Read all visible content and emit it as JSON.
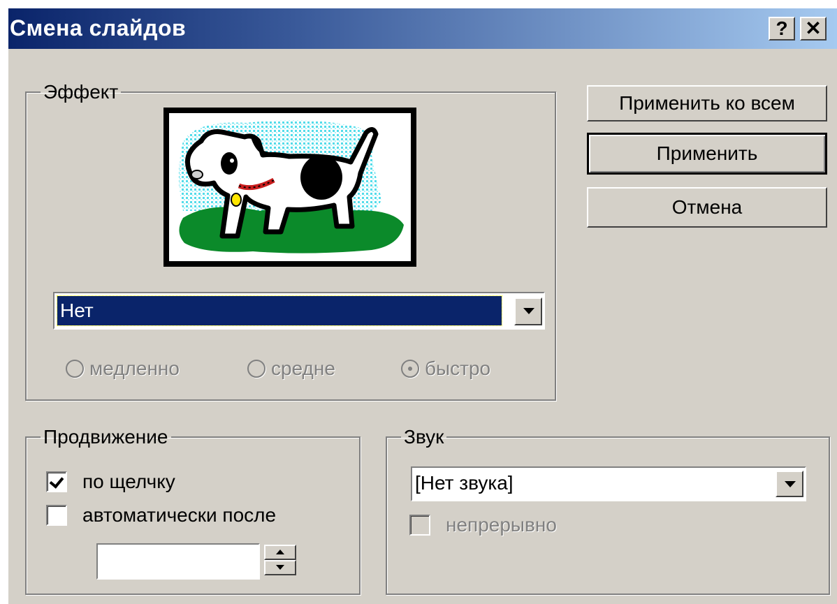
{
  "window": {
    "title": "Смена слайдов",
    "help_label": "?",
    "close_label": "✕"
  },
  "buttons": {
    "apply_all": "Применить ко всем",
    "apply": "Применить",
    "cancel": "Отмена"
  },
  "effect": {
    "legend": "Эффект",
    "preview_icon": "dog-preview-icon",
    "selected": "Нет",
    "speeds": [
      {
        "label": "медленно",
        "checked": false
      },
      {
        "label": "средне",
        "checked": false
      },
      {
        "label": "быстро",
        "checked": true
      }
    ]
  },
  "advance": {
    "legend": "Продвижение",
    "on_click": {
      "label": "по щелчку",
      "checked": true
    },
    "auto_after": {
      "label": "автоматически после",
      "checked": false
    },
    "time_value": ""
  },
  "sound": {
    "legend": "Звук",
    "selected": "[Нет звука]",
    "loop": {
      "label": "непрерывно",
      "checked": false,
      "enabled": false
    }
  },
  "colors": {
    "dialog_bg": "#d4d0c8",
    "title_start": "#0a246a",
    "title_end": "#a6caf0",
    "selection": "#0a246a"
  }
}
